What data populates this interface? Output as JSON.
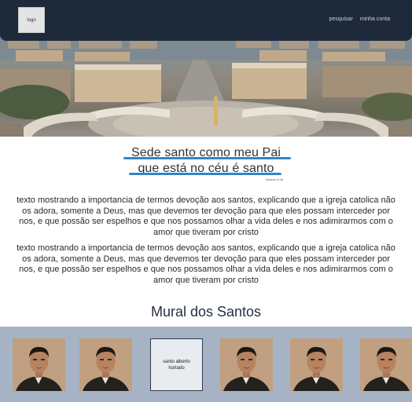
{
  "header": {
    "logo_label": "logo",
    "nav": [
      "pesquisar",
      "minha conta"
    ]
  },
  "hero": {
    "image": "st-peters-square-photo"
  },
  "quote": {
    "line1": "Sede santo como meu Pai",
    "line2": "que está no céu é santo",
    "reference": "Mateus 5:48"
  },
  "paragraphs": [
    "texto mostrando a importancia de termos devoção aos santos, explicando que a igreja catolica não os adora, somente a Deus, mas que devemos ter devoção para que eles possam interceder por nos, e que possão ser espelhos e que nos possamos olhar a vida deles e nos adimirarmos com o amor que tiveram por cristo",
    "texto mostrando a importancia de termos devoção aos santos, explicando que a igreja catolica não os adora, somente a Deus, mas que devemos ter devoção para que eles possam interceder por nos, e que possão ser espelhos e que nos possamos olhar a vida deles e nos adimirarmos com o amor que tiveram por cristo"
  ],
  "mural": {
    "title": "Mural dos Santos",
    "placeholder_text": "santo alberto hurtado"
  },
  "colors": {
    "navbar": "#1e2a3a",
    "accent_underline": "#2f86c9",
    "mural_background": "#a6b3c4"
  }
}
